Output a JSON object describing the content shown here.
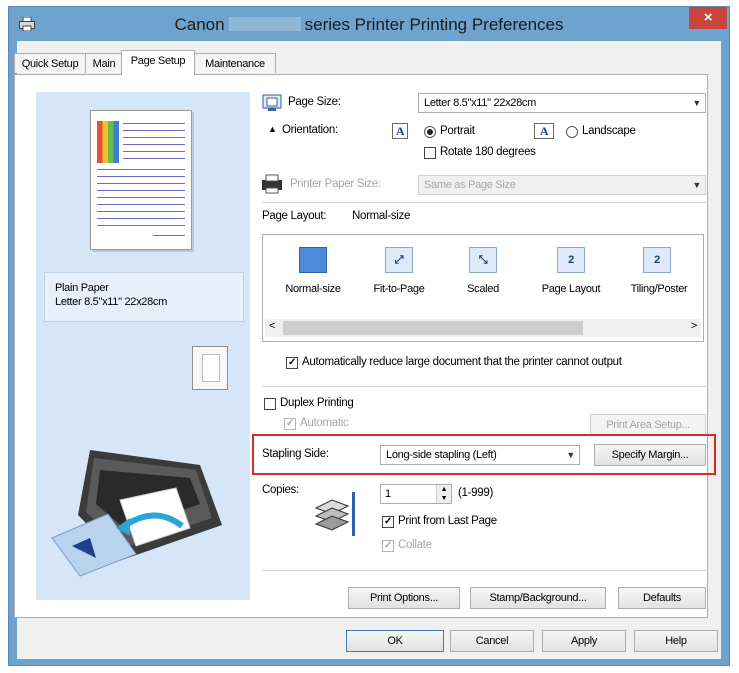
{
  "window": {
    "title_left": "Canon",
    "title_right": "series Printer Printing Preferences",
    "close_label": "×"
  },
  "tabs": [
    "Quick Setup",
    "Main",
    "Page Setup",
    "Maintenance"
  ],
  "active_tab": "Page Setup",
  "preview": {
    "paper_type": "Plain Paper",
    "paper_size": "Letter 8.5\"x11\" 22x28cm"
  },
  "page_size": {
    "label": "Page Size:",
    "value": "Letter 8.5\"x11\" 22x28cm"
  },
  "orientation": {
    "label": "Orientation:",
    "portrait": "Portrait",
    "landscape": "Landscape",
    "icon_glyph": "A",
    "selected": "Portrait",
    "rotate_label": "Rotate 180 degrees",
    "rotate_checked": false
  },
  "printer_paper_size": {
    "label": "Printer Paper Size:",
    "value": "Same as Page Size",
    "enabled": false
  },
  "page_layout": {
    "label": "Page Layout:",
    "value": "Normal-size",
    "options": [
      {
        "label": "Normal-size",
        "glyph": ""
      },
      {
        "label": "Fit-to-Page",
        "glyph": "⤢"
      },
      {
        "label": "Scaled",
        "glyph": "⤡"
      },
      {
        "label": "Page Layout",
        "glyph": "2"
      },
      {
        "label": "Tiling/Poster",
        "glyph": "2"
      }
    ],
    "selected_index": 0,
    "scroll_left": "<",
    "scroll_right": ">"
  },
  "auto_reduce": {
    "label": "Automatically reduce large document that the printer cannot output",
    "checked": true
  },
  "duplex": {
    "label": "Duplex Printing",
    "checked": false,
    "automatic_label": "Automatic",
    "automatic_checked": true,
    "automatic_enabled": false
  },
  "print_area_setup_label": "Print Area Setup...",
  "stapling_side": {
    "label": "Stapling Side:",
    "value": "Long-side stapling (Left)"
  },
  "specify_margin_label": "Specify Margin...",
  "copies": {
    "label": "Copies:",
    "value": "1",
    "range": "(1-999)",
    "print_from_last_label": "Print from Last Page",
    "print_from_last_checked": true,
    "collate_label": "Collate",
    "collate_checked": true,
    "collate_enabled": false
  },
  "buttons": {
    "print_options": "Print Options...",
    "stamp_background": "Stamp/Background...",
    "defaults": "Defaults",
    "ok": "OK",
    "cancel": "Cancel",
    "apply": "Apply",
    "help": "Help"
  },
  "colors": {
    "title_bar": "#6fa3cf",
    "close_button": "#c7453c",
    "preview_bg": "#d4e6f8",
    "highlight_box": "#d82b2b"
  },
  "icons": [
    "printer-app-icon",
    "page-size-icon",
    "printer-paper-icon",
    "orientation-portrait-icon",
    "orientation-landscape-icon",
    "paper-preview-icon",
    "printer-illustration-icon",
    "copies-stack-icon"
  ]
}
